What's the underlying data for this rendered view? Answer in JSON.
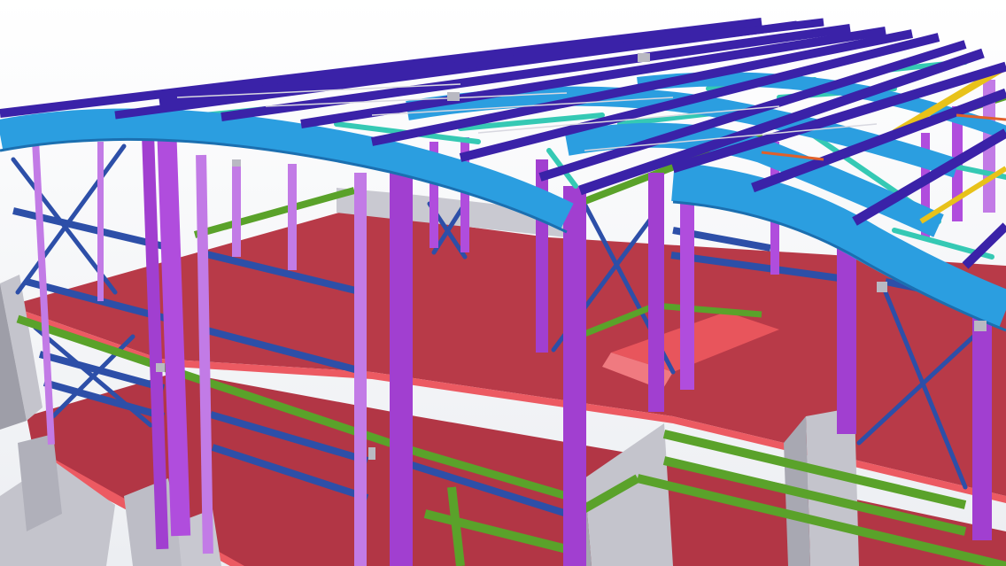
{
  "image": {
    "subject": "steel-frame-building-3d-model",
    "palette": {
      "background": "#f4f4f6",
      "concrete": "#c4c4cc",
      "concrete_dark": "#9e9ea8",
      "slab": "#b83a48",
      "slab_edge": "#ec5a62",
      "column": "#a13fd0",
      "column_light": "#c27be6",
      "rafter": "#2b9ee0",
      "rafter_dark": "#1b6fb0",
      "purlin": "#3a22a8",
      "secondary_beam": "#2d4fa8",
      "floor_beam": "#5aa22a",
      "bracing": "#35c9b4",
      "ridge_beam": "#e8c21a",
      "accent_orange": "#e0602a"
    }
  }
}
